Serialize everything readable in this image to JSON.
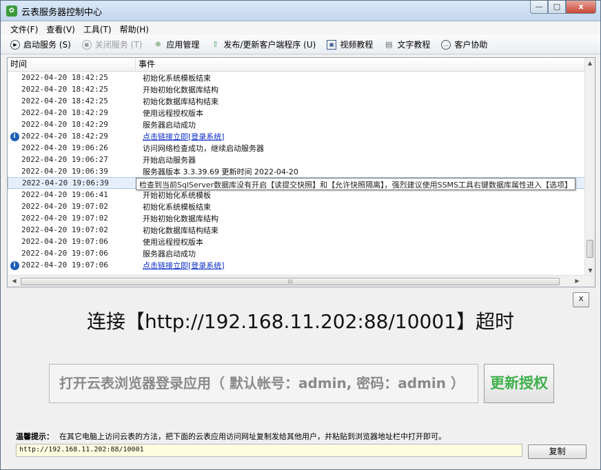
{
  "window": {
    "title": "云表服务器控制中心",
    "buttons": {
      "minimize": "—",
      "maximize": "□",
      "close": "x"
    }
  },
  "menu": [
    {
      "label": "文件(F)",
      "name": "menu-file"
    },
    {
      "label": "查看(V)",
      "name": "menu-view"
    },
    {
      "label": "工具(T)",
      "name": "menu-tools"
    },
    {
      "label": "帮助(H)",
      "name": "menu-help"
    }
  ],
  "toolbar": {
    "start": "启动服务 (S)",
    "stop": "关闭服务 (T)",
    "apps": "应用管理",
    "publish": "发布/更新客户端程序 (U)",
    "video": "视频教程",
    "text": "文字教程",
    "support": "客户协助"
  },
  "log": {
    "headers": {
      "time": "时间",
      "event": "事件"
    },
    "rows": [
      {
        "time": "2022-04-20 18:42:25",
        "event": "初始化系统模板结束",
        "icon": false,
        "link": false,
        "selected": false
      },
      {
        "time": "2022-04-20 18:42:25",
        "event": "开始初始化数据库结构",
        "icon": false,
        "link": false,
        "selected": false
      },
      {
        "time": "2022-04-20 18:42:25",
        "event": "初始化数据库结构结束",
        "icon": false,
        "link": false,
        "selected": false
      },
      {
        "time": "2022-04-20 18:42:29",
        "event": "使用远程授权版本",
        "icon": false,
        "link": false,
        "selected": false
      },
      {
        "time": "2022-04-20 18:42:29",
        "event": "服务器启动成功",
        "icon": false,
        "link": false,
        "selected": false
      },
      {
        "time": "2022-04-20 18:42:29",
        "event": "点击链接立即[登录系统]",
        "icon": true,
        "link": true,
        "selected": false
      },
      {
        "time": "2022-04-20 19:06:26",
        "event": "访问网络检查成功，继续启动服务器",
        "icon": false,
        "link": false,
        "selected": false
      },
      {
        "time": "2022-04-20 19:06:27",
        "event": "开始启动服务器",
        "icon": false,
        "link": false,
        "selected": false
      },
      {
        "time": "2022-04-20 19:06:39",
        "event": "服务器版本  3.3.39.69 更新时间 2022-04-20",
        "icon": false,
        "link": false,
        "selected": false
      },
      {
        "time": "2022-04-20 19:06:39",
        "event": "",
        "icon": false,
        "link": false,
        "selected": true
      },
      {
        "time": "2022-04-20 19:06:41",
        "event": "开始初始化系统模板",
        "icon": false,
        "link": false,
        "selected": false
      },
      {
        "time": "2022-04-20 19:07:02",
        "event": "初始化系统模板结束",
        "icon": false,
        "link": false,
        "selected": false
      },
      {
        "time": "2022-04-20 19:07:02",
        "event": "开始初始化数据库结构",
        "icon": false,
        "link": false,
        "selected": false
      },
      {
        "time": "2022-04-20 19:07:02",
        "event": "初始化数据库结构结束",
        "icon": false,
        "link": false,
        "selected": false
      },
      {
        "time": "2022-04-20 19:07:06",
        "event": "使用远程授权版本",
        "icon": false,
        "link": false,
        "selected": false
      },
      {
        "time": "2022-04-20 19:07:06",
        "event": "服务器启动成功",
        "icon": false,
        "link": false,
        "selected": false
      },
      {
        "time": "2022-04-20 19:07:06",
        "event": "点击链接立即[登录系统]",
        "icon": true,
        "link": true,
        "selected": false
      }
    ],
    "tooltip": "检查到当前SqlServer数据库没有开启【读提交快照】和【允许快照隔离】，强烈建议使用SSMS工具右键数据库属性进入【选项】"
  },
  "panel": {
    "close_label": "X",
    "connect_message": "连接【http://192.168.11.202:88/10001】超时",
    "open_button": "打开云表浏览器登录应用（ 默认帐号：admin, 密码：admin ）",
    "renew_button": "更新授权",
    "tip_label": "温馨提示：",
    "tip_text": "在其它电脑上访问云表的方法，把下面的云表应用访问网址复制发给其他用户，并粘贴到浏览器地址栏中打开即可。",
    "url_value": "http://192.168.11.202:88/10001",
    "copy_button": "复制"
  },
  "colors": {
    "link": "#0a2cc7",
    "renew": "#3eb04a",
    "info_icon": "#1f5fb8"
  }
}
